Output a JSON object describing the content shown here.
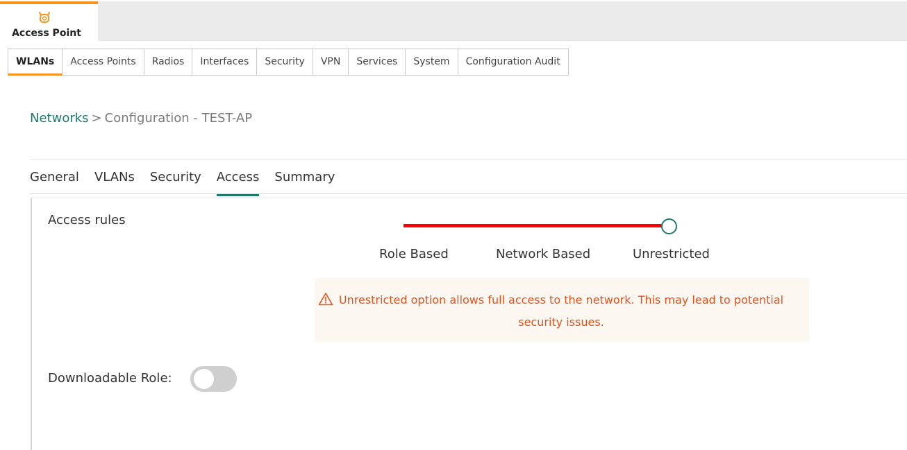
{
  "app": {
    "title": "Access Point",
    "accent": "#f7931e"
  },
  "nav": {
    "items": [
      {
        "label": "WLANs",
        "active": true
      },
      {
        "label": "Access Points"
      },
      {
        "label": "Radios"
      },
      {
        "label": "Interfaces"
      },
      {
        "label": "Security"
      },
      {
        "label": "VPN"
      },
      {
        "label": "Services"
      },
      {
        "label": "System"
      },
      {
        "label": "Configuration Audit"
      }
    ]
  },
  "breadcrumb": {
    "link": "Networks",
    "separator": ">",
    "current": "Configuration - TEST-AP"
  },
  "subtabs": [
    {
      "label": "General"
    },
    {
      "label": "VLANs"
    },
    {
      "label": "Security"
    },
    {
      "label": "Access",
      "active": true
    },
    {
      "label": "Summary"
    }
  ],
  "access": {
    "label": "Access rules",
    "options": [
      "Role Based",
      "Network Based",
      "Unrestricted"
    ],
    "selected": "Unrestricted",
    "track_color": "#ff0000",
    "warning": {
      "icon": "warning-triangle-icon",
      "text": "Unrestricted option allows full access to the network. This may lead to potential security issues.",
      "color": "#e4521b"
    }
  },
  "downloadable_role": {
    "label": "Downloadable Role:",
    "enabled": false
  }
}
